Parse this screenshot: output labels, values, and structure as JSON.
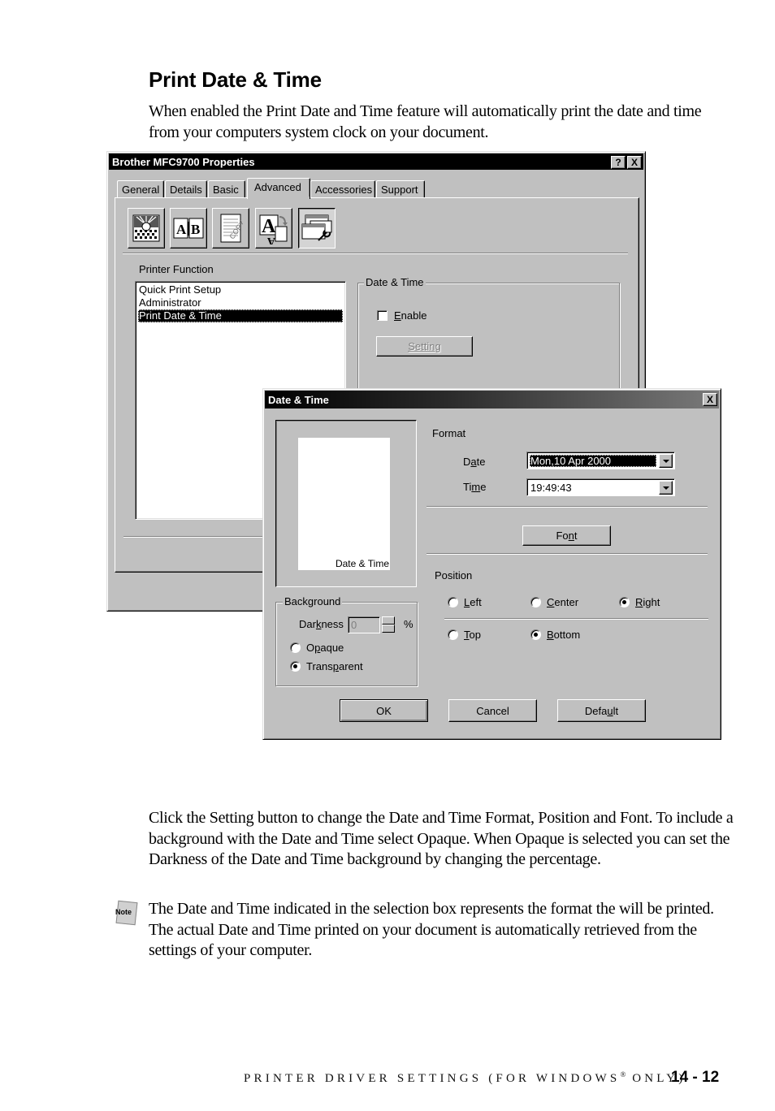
{
  "heading": "Print Date & Time",
  "intro": "When enabled the Print Date and Time feature will automatically print the date and time from your computers system clock on your document.",
  "properties_window": {
    "title": "Brother MFC9700 Properties",
    "help_button": "?",
    "close_button": "X",
    "tabs": [
      {
        "label": "General",
        "active": false
      },
      {
        "label": "Details",
        "active": false
      },
      {
        "label": "Basic",
        "active": false
      },
      {
        "label": "Advanced",
        "active": true
      },
      {
        "label": "Accessories",
        "active": false
      },
      {
        "label": "Support",
        "active": false
      }
    ],
    "toolbar_icons": [
      {
        "name": "print-quality-icon",
        "pressed": false
      },
      {
        "name": "duplex-icon",
        "pressed": false,
        "glyph": "A|B"
      },
      {
        "name": "watermark-icon",
        "pressed": false,
        "glyph": "COPY"
      },
      {
        "name": "font-substitution-icon",
        "pressed": false,
        "glyph": "A"
      },
      {
        "name": "printer-function-icon",
        "pressed": true
      }
    ],
    "printer_function_label": "Printer Function",
    "printer_functions": [
      {
        "label": "Quick Print Setup",
        "selected": false
      },
      {
        "label": "Administrator",
        "selected": false
      },
      {
        "label": "Print Date & Time",
        "selected": true
      }
    ],
    "date_time_group": {
      "label": "Date & Time",
      "enable_label": "Enable",
      "enable_checked": false,
      "setting_button": "Setting",
      "setting_enabled": false
    }
  },
  "date_time_dialog": {
    "title": "Date & Time",
    "close_button": "X",
    "preview_text": "Date & Time",
    "format_label": "Format",
    "date_label": "Date",
    "date_value": "Mon,10 Apr 2000",
    "time_label": "Time",
    "time_value": "19:49:43",
    "font_button": "Font",
    "position_label": "Position",
    "horizontal_options": [
      {
        "label": "Left",
        "selected": false
      },
      {
        "label": "Center",
        "selected": false
      },
      {
        "label": "Right",
        "selected": true
      }
    ],
    "vertical_options": [
      {
        "label": "Top",
        "selected": false
      },
      {
        "label": "Bottom",
        "selected": true
      }
    ],
    "background": {
      "label": "Background",
      "darkness_label": "Darkness",
      "darkness_value": "0",
      "darkness_unit": "%",
      "options": [
        {
          "label": "Opaque",
          "selected": false
        },
        {
          "label": "Transparent",
          "selected": true
        }
      ]
    },
    "ok_button": "OK",
    "cancel_button": "Cancel",
    "default_button": "Default"
  },
  "body_paragraph": "Click the Setting button to change the Date and Time Format, Position and Font. To include a background with the Date and Time select Opaque. When Opaque is selected you can set the Darkness of the Date and Time background by changing the percentage.",
  "note": {
    "icon_label": "Note",
    "text": "The Date and Time indicated in the selection box represents the format the will be printed. The actual Date and Time printed on your document is automatically retrieved from the settings of your computer."
  },
  "footer": {
    "section": "PRINTER DRIVER SETTINGS (FOR WINDOWS",
    "registered": "®",
    "section_end": " ONLY)",
    "page": "14 - 12"
  }
}
